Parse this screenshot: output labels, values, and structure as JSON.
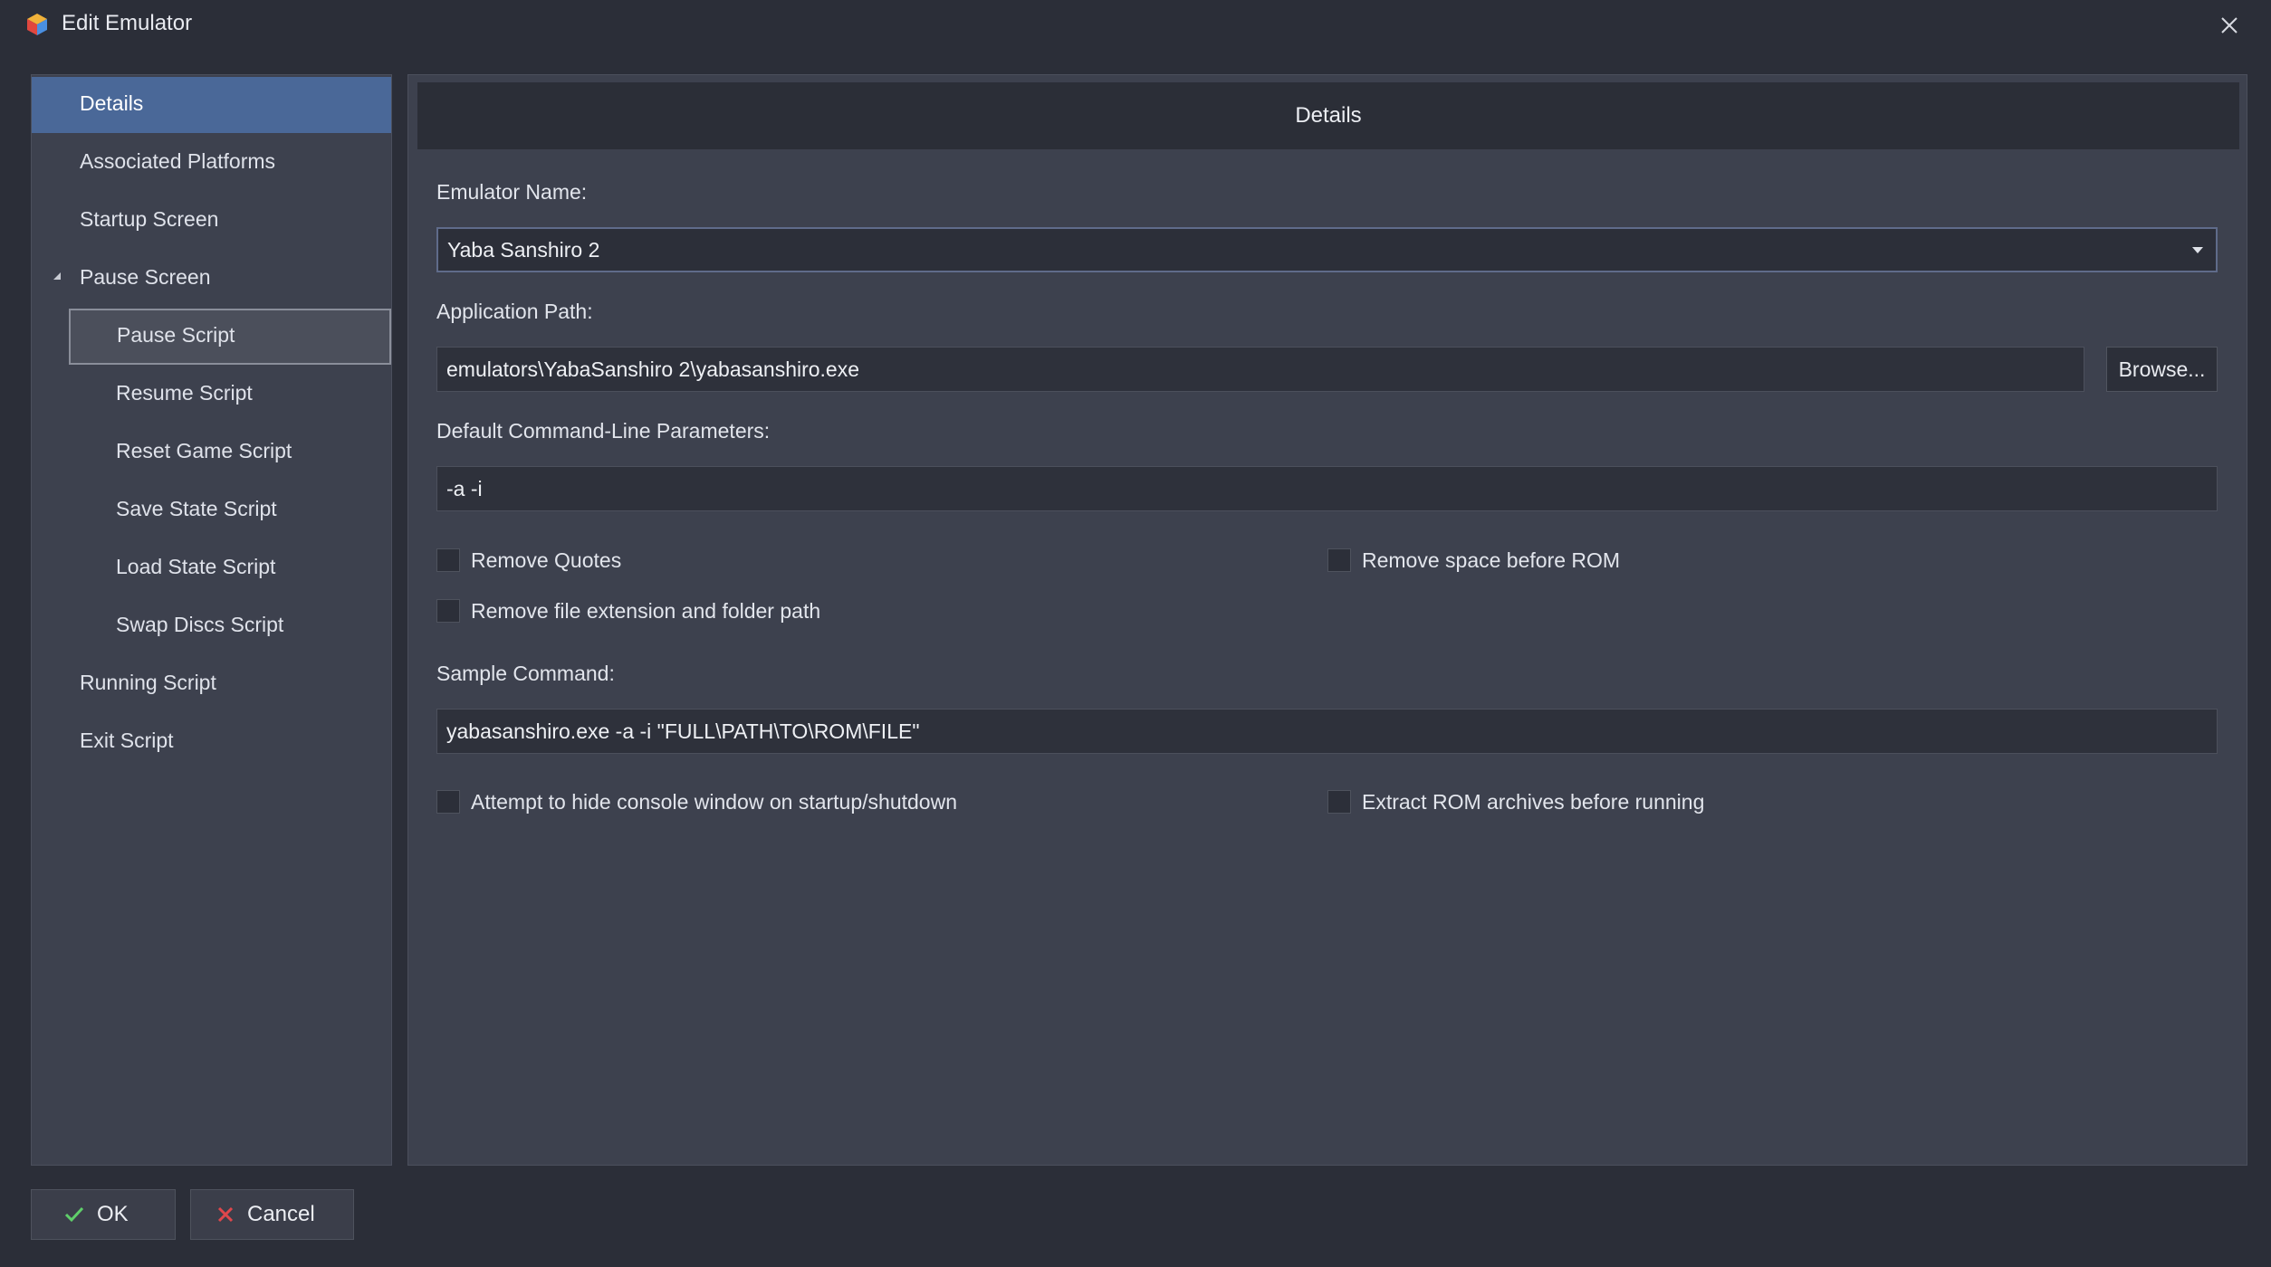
{
  "window": {
    "title": "Edit Emulator"
  },
  "sidebar": {
    "items": [
      {
        "label": "Details",
        "state": "active"
      },
      {
        "label": "Associated Platforms"
      },
      {
        "label": "Startup Screen"
      },
      {
        "label": "Pause Screen",
        "expanded": true
      },
      {
        "label": "Pause Script",
        "state": "selected",
        "indent": true
      },
      {
        "label": "Resume Script",
        "indent": true
      },
      {
        "label": "Reset Game Script",
        "indent": true
      },
      {
        "label": "Save State Script",
        "indent": true
      },
      {
        "label": "Load State Script",
        "indent": true
      },
      {
        "label": "Swap Discs Script",
        "indent": true
      },
      {
        "label": "Running Script"
      },
      {
        "label": "Exit Script"
      }
    ]
  },
  "details": {
    "header": "Details",
    "emulator_name_label": "Emulator Name:",
    "emulator_name_value": "Yaba Sanshiro 2",
    "app_path_label": "Application Path:",
    "app_path_value": "emulators\\YabaSanshiro 2\\yabasanshiro.exe",
    "browse_label": "Browse...",
    "params_label": "Default Command-Line Parameters:",
    "params_value": "-a -i",
    "remove_quotes_label": "Remove Quotes",
    "remove_space_label": "Remove space before ROM",
    "remove_ext_label": "Remove file extension and folder path",
    "sample_label": "Sample Command:",
    "sample_value": "yabasanshiro.exe -a -i \"FULL\\PATH\\TO\\ROM\\FILE\"",
    "hide_console_label": "Attempt to hide console window on startup/shutdown",
    "extract_rom_label": "Extract ROM archives before running"
  },
  "footer": {
    "ok_label": "OK",
    "cancel_label": "Cancel"
  },
  "colors": {
    "background": "#2b2e38",
    "panel": "#3d414e",
    "active": "#4a6898",
    "ok_check": "#5fcf6a",
    "cancel_x": "#e0474c"
  }
}
